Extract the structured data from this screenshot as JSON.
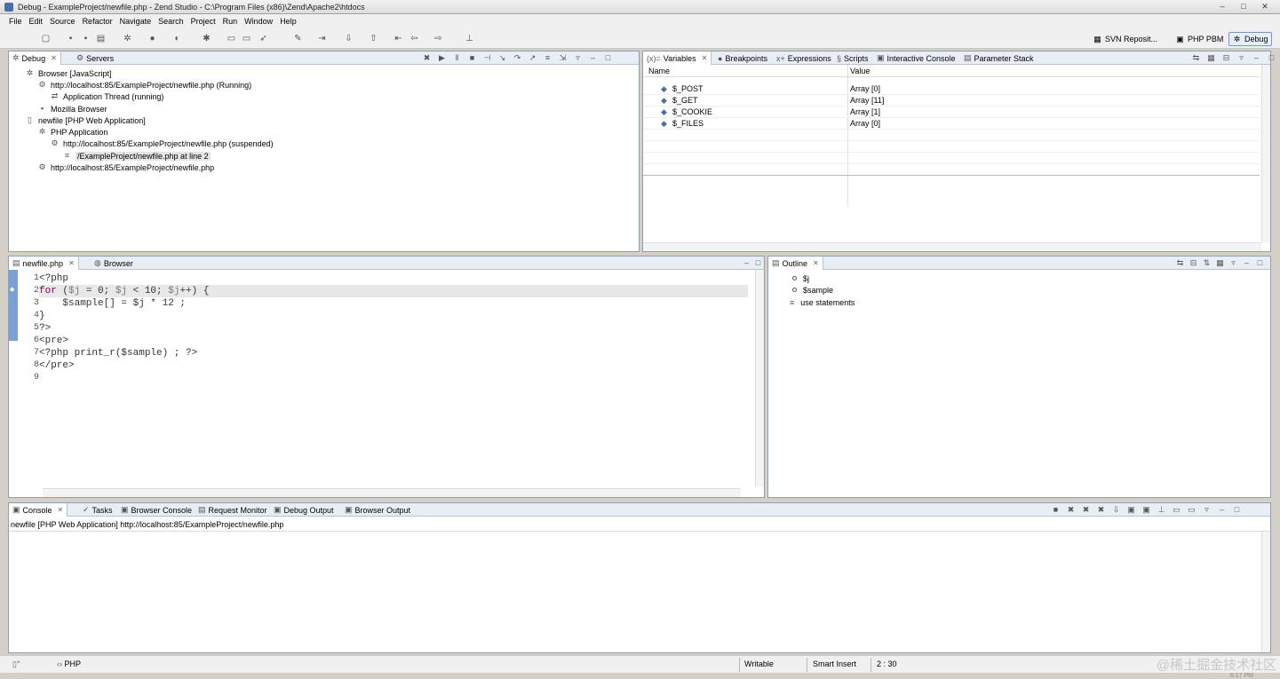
{
  "window": {
    "title": "Debug - ExampleProject/newfile.php - Zend Studio - C:\\Program Files (x86)\\Zend\\Apache2\\htdocs",
    "controls": [
      "–",
      "□",
      "✕"
    ]
  },
  "menu": [
    "File",
    "Edit",
    "Source",
    "Refactor",
    "Navigate",
    "Search",
    "Project",
    "Run",
    "Window",
    "Help"
  ],
  "perspectives": [
    {
      "label": "SVN Reposit...",
      "icon": "svn-icon"
    },
    {
      "label": "PHP PBM",
      "icon": "php-icon"
    },
    {
      "label": "Debug",
      "icon": "debug-icon",
      "active": true
    }
  ],
  "debug_view": {
    "tabs": [
      {
        "label": "Debug"
      },
      {
        "label": "Servers"
      }
    ],
    "tree": [
      {
        "label": "Browser [JavaScript]",
        "icon": "browser-icon"
      },
      {
        "label": "http://localhost:85/ExampleProject/newfile.php (Running)",
        "icon": "process-icon"
      },
      {
        "label": "Application Thread (running)",
        "icon": "thread-icon"
      },
      {
        "label": "Mozilla Browser",
        "icon": "browser-icon"
      },
      {
        "label": "newfile [PHP Web Application]",
        "icon": "launch-icon"
      },
      {
        "label": "PHP Application",
        "icon": "app-icon"
      },
      {
        "label": "http://localhost:85/ExampleProject/newfile.php (suspended)",
        "icon": "process-icon"
      },
      {
        "label": "/ExampleProject/newfile.php at line 2",
        "icon": "stackframe-icon",
        "selected": true
      },
      {
        "label": "http://localhost:85/ExampleProject/newfile.php",
        "icon": "process-icon"
      }
    ]
  },
  "variables_view": {
    "tabs": [
      {
        "label": "Variables"
      },
      {
        "label": "Breakpoints"
      },
      {
        "label": "Expressions"
      },
      {
        "label": "Scripts"
      },
      {
        "label": "Interactive Console"
      },
      {
        "label": "Parameter Stack"
      }
    ],
    "columns": {
      "name": "Name",
      "value": "Value"
    },
    "rows": [
      {
        "name": "$_POST",
        "value": "Array [0]"
      },
      {
        "name": "$_GET",
        "value": "Array [11]"
      },
      {
        "name": "$_COOKIE",
        "value": "Array [1]"
      },
      {
        "name": "$_FILES",
        "value": "Array [0]"
      }
    ]
  },
  "editor": {
    "tabs": [
      {
        "label": "newfile.php"
      },
      {
        "label": "Browser"
      }
    ],
    "lines": [
      {
        "num": "1",
        "html": "&lt;?php"
      },
      {
        "num": "2",
        "html": "<span class=\"kw\">for</span> (<span class=\"var\">$j</span> = 0; <span class=\"var\">$j</span> &lt; 10; <span class=\"var\">$j</span>++) {"
      },
      {
        "num": "3",
        "html": "    $sample[] = $j * 12 ;"
      },
      {
        "num": "4",
        "html": "}"
      },
      {
        "num": "5",
        "html": "?&gt;"
      },
      {
        "num": "6",
        "html": "&lt;pre&gt;"
      },
      {
        "num": "7",
        "html": "&lt;?php print_r($sample) ; ?&gt;"
      },
      {
        "num": "8",
        "html": "&lt;/pre&gt;"
      },
      {
        "num": "9",
        "html": ""
      }
    ],
    "current_line": 2
  },
  "outline": {
    "tabs": [
      {
        "label": "Outline"
      }
    ],
    "items": [
      {
        "label": "$j",
        "icon": "variable-icon"
      },
      {
        "label": "$sample",
        "icon": "variable-icon"
      },
      {
        "label": "use statements",
        "icon": "use-statements-icon"
      }
    ]
  },
  "console": {
    "tabs": [
      {
        "label": "Console"
      },
      {
        "label": "Tasks"
      },
      {
        "label": "Browser Console"
      },
      {
        "label": "Request Monitor"
      },
      {
        "label": "Debug Output"
      },
      {
        "label": "Browser Output"
      }
    ],
    "header": "newfile [PHP Web Application] http://localhost:85/ExampleProject/newfile.php"
  },
  "status": {
    "language": "PHP",
    "writable": "Writable",
    "insert_mode": "Smart Insert",
    "position": "2 : 30"
  },
  "watermark": "@稀土掘金技术社区",
  "clock": "6:17 PM"
}
